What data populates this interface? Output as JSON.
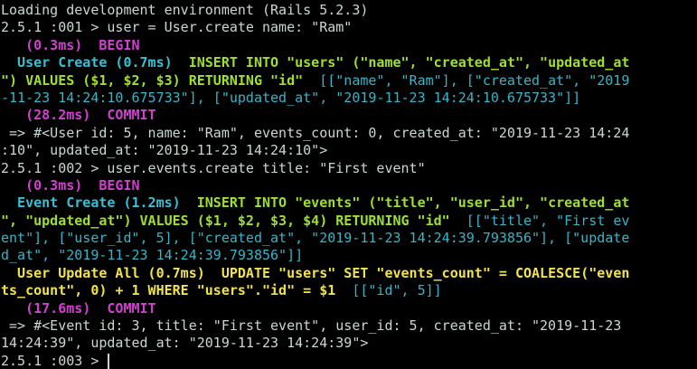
{
  "terminal": {
    "colors": {
      "background": "#000000",
      "default_text": "#c7d9cf",
      "magenta_bold": "#d33fd0",
      "cyan_bold": "#35c2d6",
      "green_bold": "#9fe02f",
      "yellow_bold": "#f2e34a",
      "cyan": "#36b5c9"
    },
    "lines": [
      [
        {
          "text": "Loading development environment (Rails 5.2.3)",
          "style": "default"
        }
      ],
      [
        {
          "text": "2.5.1 :001 > user = User.create name: \"Ram\"",
          "style": "default"
        }
      ],
      [
        {
          "text": "   (0.3ms)  BEGIN",
          "style": "magenta-bold"
        }
      ],
      [
        {
          "text": "  User Create (0.7ms)  ",
          "style": "cyan-bold"
        },
        {
          "text": "INSERT INTO \"users\" (\"name\", \"created_at\", \"updated_at",
          "style": "green-bold"
        }
      ],
      [
        {
          "text": "\") VALUES ($1, $2, $3) RETURNING \"id\"",
          "style": "green-bold"
        },
        {
          "text": "  [[\"name\", \"Ram\"], [\"created_at\", \"2019",
          "style": "cyan"
        }
      ],
      [
        {
          "text": "-11-23 14:24:10.675733\"], [\"updated_at\", \"2019-11-23 14:24:10.675733\"]]",
          "style": "cyan"
        }
      ],
      [
        {
          "text": "   (28.2ms)  COMMIT",
          "style": "magenta-bold"
        }
      ],
      [
        {
          "text": " => #<User id: 5, name: \"Ram\", events_count: 0, created_at: \"2019-11-23 14:24",
          "style": "default"
        }
      ],
      [
        {
          "text": ":10\", updated_at: \"2019-11-23 14:24:10\">",
          "style": "default"
        }
      ],
      [
        {
          "text": "2.5.1 :002 > user.events.create title: \"First event\"",
          "style": "default"
        }
      ],
      [
        {
          "text": "   (0.3ms)  BEGIN",
          "style": "magenta-bold"
        }
      ],
      [
        {
          "text": "  Event Create (1.2ms)  ",
          "style": "cyan-bold"
        },
        {
          "text": "INSERT INTO \"events\" (\"title\", \"user_id\", \"created_at",
          "style": "green-bold"
        }
      ],
      [
        {
          "text": "\", \"updated_at\") VALUES ($1, $2, $3, $4) RETURNING \"id\"",
          "style": "green-bold"
        },
        {
          "text": "  [[\"title\", \"First ev",
          "style": "cyan"
        }
      ],
      [
        {
          "text": "ent\"], [\"user_id\", 5], [\"created_at\", \"2019-11-23 14:24:39.793856\"], [\"update",
          "style": "cyan"
        }
      ],
      [
        {
          "text": "d_at\", \"2019-11-23 14:24:39.793856\"]]",
          "style": "cyan"
        }
      ],
      [
        {
          "text": "  User Update All (0.7ms)  ",
          "style": "yellow-bold"
        },
        {
          "text": "UPDATE \"users\" SET \"events_count\" = COALESCE(\"even",
          "style": "yellow-bold"
        }
      ],
      [
        {
          "text": "ts_count\", 0) + 1 WHERE \"users\".\"id\" = $1",
          "style": "yellow-bold"
        },
        {
          "text": "  [[\"id\", 5]]",
          "style": "cyan"
        }
      ],
      [
        {
          "text": "   (17.6ms)  COMMIT",
          "style": "magenta-bold"
        }
      ],
      [
        {
          "text": " => #<Event id: 3, title: \"First event\", user_id: 5, created_at: \"2019-11-23",
          "style": "default"
        }
      ],
      [
        {
          "text": "14:24:39\", updated_at: \"2019-11-23 14:24:39\">",
          "style": "default"
        }
      ],
      [
        {
          "text": "2.5.1 :003 > ",
          "style": "default"
        }
      ]
    ]
  }
}
